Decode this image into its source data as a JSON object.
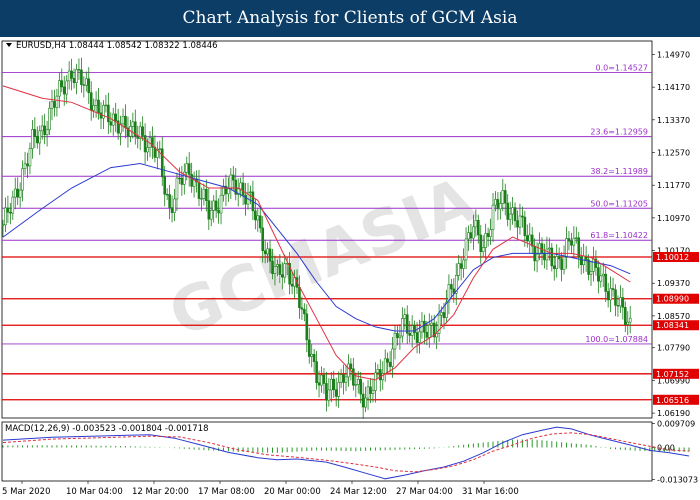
{
  "banner": {
    "title": "Chart Analysis for Clients of GCM Asia"
  },
  "watermark": "GCMASIA",
  "colors": {
    "candle": "#1a7f1a",
    "ma_fast": "#e03040",
    "ma_slow": "#2a3ad0",
    "fib": "#9b30c8",
    "level": "#e00000",
    "hist": "#2a9a2a",
    "macd": "#2a3ad0",
    "signal": "#e03040"
  },
  "chart_data": [
    {
      "type": "candlestick",
      "symbol_header": "EURUSD,H4  1.08444 1.08542 1.08322 1.08446",
      "ylim": [
        1.0607,
        1.153
      ],
      "y_ticks": [
        "1.14970",
        "1.14170",
        "1.13370",
        "1.12570",
        "1.11770",
        "1.10970",
        "1.10170",
        "1.09370",
        "1.08570",
        "1.07790",
        "1.06990",
        "1.06190"
      ],
      "x_ticks": [
        "5 Mar 2020",
        "10 Mar 04:00",
        "12 Mar 20:00",
        "17 Mar 08:00",
        "20 Mar 00:00",
        "24 Mar 12:00",
        "27 Mar 04:00",
        "31 Mar 16:00"
      ],
      "fib_levels": [
        {
          "label": "0.0=1.14527",
          "value": 1.14527
        },
        {
          "label": "23.6=1.12959",
          "value": 1.12959
        },
        {
          "label": "38.2=1.11989",
          "value": 1.11989
        },
        {
          "label": "50.0=1.11205",
          "value": 1.11205
        },
        {
          "label": "61.8=1.10422",
          "value": 1.10422
        },
        {
          "label": "100.0=1.07884",
          "value": 1.07884
        }
      ],
      "levels": [
        {
          "label": "1.10012",
          "value": 1.10012
        },
        {
          "label": "1.08990",
          "value": 1.0899
        },
        {
          "label": "1.08341",
          "value": 1.08341
        },
        {
          "label": "1.07152",
          "value": 1.07152
        },
        {
          "label": "1.06516",
          "value": 1.06516
        }
      ],
      "close_path": [
        [
          0,
          1.108
        ],
        [
          4,
          1.113
        ],
        [
          8,
          1.121
        ],
        [
          12,
          1.128
        ],
        [
          16,
          1.131
        ],
        [
          20,
          1.137
        ],
        [
          24,
          1.141
        ],
        [
          28,
          1.146
        ],
        [
          32,
          1.143
        ],
        [
          36,
          1.139
        ],
        [
          40,
          1.136
        ],
        [
          44,
          1.133
        ],
        [
          48,
          1.134
        ],
        [
          52,
          1.13
        ],
        [
          56,
          1.131
        ],
        [
          60,
          1.127
        ],
        [
          64,
          1.124
        ],
        [
          68,
          1.112
        ],
        [
          72,
          1.118
        ],
        [
          76,
          1.122
        ],
        [
          80,
          1.116
        ],
        [
          84,
          1.111
        ],
        [
          88,
          1.114
        ],
        [
          92,
          1.117
        ],
        [
          96,
          1.118
        ],
        [
          100,
          1.115
        ],
        [
          104,
          1.108
        ],
        [
          108,
          1.101
        ],
        [
          112,
          1.095
        ],
        [
          116,
          1.098
        ],
        [
          120,
          1.092
        ],
        [
          124,
          1.08
        ],
        [
          128,
          1.072
        ],
        [
          132,
          1.066
        ],
        [
          136,
          1.069
        ],
        [
          140,
          1.072
        ],
        [
          144,
          1.069
        ],
        [
          148,
          1.066
        ],
        [
          152,
          1.069
        ],
        [
          156,
          1.074
        ],
        [
          160,
          1.079
        ],
        [
          164,
          1.084
        ],
        [
          168,
          1.082
        ],
        [
          172,
          1.081
        ],
        [
          176,
          1.083
        ],
        [
          180,
          1.087
        ],
        [
          184,
          1.093
        ],
        [
          188,
          1.102
        ],
        [
          192,
          1.107
        ],
        [
          196,
          1.103
        ],
        [
          200,
          1.111
        ],
        [
          204,
          1.114
        ],
        [
          208,
          1.111
        ],
        [
          212,
          1.107
        ],
        [
          216,
          1.103
        ],
        [
          220,
          1.101
        ],
        [
          224,
          1.099
        ],
        [
          228,
          1.1
        ],
        [
          232,
          1.104
        ],
        [
          236,
          1.101
        ],
        [
          240,
          1.097
        ],
        [
          244,
          1.095
        ],
        [
          248,
          1.092
        ],
        [
          252,
          1.087
        ],
        [
          256,
          1.084
        ]
      ],
      "ma_fast": [
        [
          0,
          1.142
        ],
        [
          16,
          1.139
        ],
        [
          28,
          1.138
        ],
        [
          44,
          1.134
        ],
        [
          60,
          1.128
        ],
        [
          72,
          1.121
        ],
        [
          84,
          1.117
        ],
        [
          96,
          1.117
        ],
        [
          104,
          1.114
        ],
        [
          112,
          1.104
        ],
        [
          120,
          1.094
        ],
        [
          128,
          1.085
        ],
        [
          136,
          1.076
        ],
        [
          144,
          1.071
        ],
        [
          152,
          1.07
        ],
        [
          160,
          1.073
        ],
        [
          168,
          1.078
        ],
        [
          176,
          1.081
        ],
        [
          184,
          1.086
        ],
        [
          192,
          1.095
        ],
        [
          200,
          1.102
        ],
        [
          208,
          1.105
        ],
        [
          216,
          1.103
        ],
        [
          224,
          1.101
        ],
        [
          232,
          1.101
        ],
        [
          240,
          1.1
        ],
        [
          248,
          1.097
        ],
        [
          256,
          1.094
        ]
      ],
      "ma_slow": [
        [
          0,
          1.105
        ],
        [
          16,
          1.112
        ],
        [
          28,
          1.117
        ],
        [
          44,
          1.122
        ],
        [
          56,
          1.123
        ],
        [
          68,
          1.121
        ],
        [
          80,
          1.119
        ],
        [
          92,
          1.117
        ],
        [
          104,
          1.113
        ],
        [
          112,
          1.107
        ],
        [
          120,
          1.101
        ],
        [
          128,
          1.094
        ],
        [
          136,
          1.088
        ],
        [
          144,
          1.085
        ],
        [
          152,
          1.083
        ],
        [
          160,
          1.082
        ],
        [
          168,
          1.082
        ],
        [
          176,
          1.085
        ],
        [
          184,
          1.091
        ],
        [
          192,
          1.097
        ],
        [
          200,
          1.1
        ],
        [
          208,
          1.101
        ],
        [
          216,
          1.101
        ],
        [
          224,
          1.101
        ],
        [
          232,
          1.1
        ],
        [
          240,
          1.099
        ],
        [
          248,
          1.098
        ],
        [
          256,
          1.096
        ]
      ]
    },
    {
      "type": "macd",
      "label": "MACD(12,26,9) -0.003523 -0.001804 -0.001718",
      "ylim": [
        -0.0137,
        0.0104
      ],
      "y_ticks": [
        "0.009709",
        "0.00",
        "-0.013073"
      ],
      "macd": [
        [
          0,
          0.003
        ],
        [
          20,
          0.0042
        ],
        [
          40,
          0.0047
        ],
        [
          60,
          0.0052
        ],
        [
          70,
          0.0038
        ],
        [
          80,
          0.0012
        ],
        [
          92,
          -0.002
        ],
        [
          104,
          -0.0042
        ],
        [
          112,
          -0.005
        ],
        [
          120,
          -0.0047
        ],
        [
          132,
          -0.006
        ],
        [
          140,
          -0.0082
        ],
        [
          148,
          -0.0105
        ],
        [
          156,
          -0.0128
        ],
        [
          164,
          -0.0113
        ],
        [
          172,
          -0.0095
        ],
        [
          180,
          -0.008
        ],
        [
          188,
          -0.0056
        ],
        [
          196,
          -0.0022
        ],
        [
          204,
          0.002
        ],
        [
          212,
          0.0052
        ],
        [
          220,
          0.007
        ],
        [
          226,
          0.0083
        ],
        [
          232,
          0.0076
        ],
        [
          240,
          0.005
        ],
        [
          248,
          0.003
        ],
        [
          256,
          0.001
        ],
        [
          264,
          -0.0012
        ],
        [
          272,
          -0.0022
        ],
        [
          280,
          -0.0035
        ]
      ],
      "signal": [
        [
          0,
          0.002
        ],
        [
          20,
          0.0034
        ],
        [
          40,
          0.004
        ],
        [
          60,
          0.0046
        ],
        [
          72,
          0.0043
        ],
        [
          84,
          0.002
        ],
        [
          96,
          -0.001
        ],
        [
          108,
          -0.003
        ],
        [
          120,
          -0.004
        ],
        [
          132,
          -0.0052
        ],
        [
          144,
          -0.0068
        ],
        [
          152,
          -0.008
        ],
        [
          160,
          -0.0095
        ],
        [
          168,
          -0.01
        ],
        [
          176,
          -0.009
        ],
        [
          184,
          -0.0075
        ],
        [
          192,
          -0.005
        ],
        [
          200,
          -0.0015
        ],
        [
          208,
          0.001
        ],
        [
          216,
          0.0038
        ],
        [
          224,
          0.0055
        ],
        [
          232,
          0.006
        ],
        [
          240,
          0.0052
        ],
        [
          248,
          0.0036
        ],
        [
          256,
          0.002
        ],
        [
          264,
          0.0005
        ],
        [
          272,
          -0.001
        ],
        [
          280,
          -0.0015
        ]
      ],
      "histogram": [
        [
          0,
          0.0008
        ],
        [
          16,
          0.0009
        ],
        [
          32,
          0.0008
        ],
        [
          48,
          0.0006
        ],
        [
          64,
          0.0002
        ],
        [
          80,
          -0.001
        ],
        [
          96,
          -0.0018
        ],
        [
          112,
          -0.0022
        ],
        [
          128,
          -0.0012
        ],
        [
          144,
          -0.0015
        ],
        [
          160,
          -0.001
        ],
        [
          176,
          -0.0004
        ],
        [
          192,
          0.0016
        ],
        [
          208,
          0.0032
        ],
        [
          216,
          0.0033
        ],
        [
          224,
          0.0026
        ],
        [
          232,
          0.0017
        ],
        [
          240,
          0.001
        ],
        [
          248,
          -0.0006
        ],
        [
          256,
          -0.0012
        ],
        [
          264,
          -0.0016
        ],
        [
          272,
          -0.0017
        ],
        [
          280,
          -0.0017
        ]
      ]
    }
  ]
}
